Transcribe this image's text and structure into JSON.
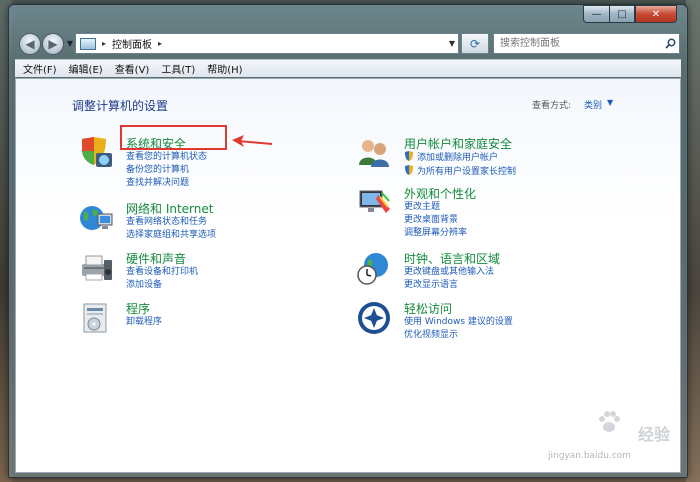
{
  "window": {
    "address": {
      "segments": [
        "控制面板"
      ],
      "separator": "▸"
    },
    "search_placeholder": "搜索控制面板",
    "buttons": {
      "minimize": "—",
      "maximize": "□",
      "close": "✕"
    }
  },
  "menubar": [
    "文件(F)",
    "编辑(E)",
    "查看(V)",
    "工具(T)",
    "帮助(H)"
  ],
  "page": {
    "title": "调整计算机的设置",
    "view_by_label": "查看方式:",
    "view_by_value": "类别"
  },
  "categories_left": [
    {
      "title": "系统和安全",
      "icon": "shield-flag-icon",
      "links": [
        "查看您的计算机状态",
        "备份您的计算机",
        "查找并解决问题"
      ]
    },
    {
      "title": "网络和 Internet",
      "icon": "network-globe-icon",
      "links": [
        "查看网络状态和任务",
        "选择家庭组和共享选项"
      ]
    },
    {
      "title": "硬件和声音",
      "icon": "printer-speaker-icon",
      "links": [
        "查看设备和打印机",
        "添加设备"
      ]
    },
    {
      "title": "程序",
      "icon": "programs-box-icon",
      "links": [
        "卸载程序"
      ]
    }
  ],
  "categories_right": [
    {
      "title": "用户帐户和家庭安全",
      "icon": "users-icon",
      "links": [
        "添加或删除用户帐户",
        "为所有用户设置家长控制"
      ]
    },
    {
      "title": "外观和个性化",
      "icon": "appearance-icon",
      "links": [
        "更改主题",
        "更改桌面背景",
        "调整屏幕分辨率"
      ]
    },
    {
      "title": "时钟、语言和区域",
      "icon": "clock-globe-icon",
      "links": [
        "更改键盘或其他输入法",
        "更改显示语言"
      ]
    },
    {
      "title": "轻松访问",
      "icon": "ease-of-access-icon",
      "links": [
        "使用 Windows 建议的设置",
        "优化视频显示"
      ]
    }
  ],
  "watermark": {
    "brand": "Bai",
    "brand2": "du",
    "jingyan": "经验",
    "url": "jingyan.baidu.com"
  },
  "colors": {
    "heading_green": "#138a3c",
    "link_blue": "#1e5bb8",
    "title_blue": "#1e3a8a",
    "highlight_red": "#e03a30"
  }
}
